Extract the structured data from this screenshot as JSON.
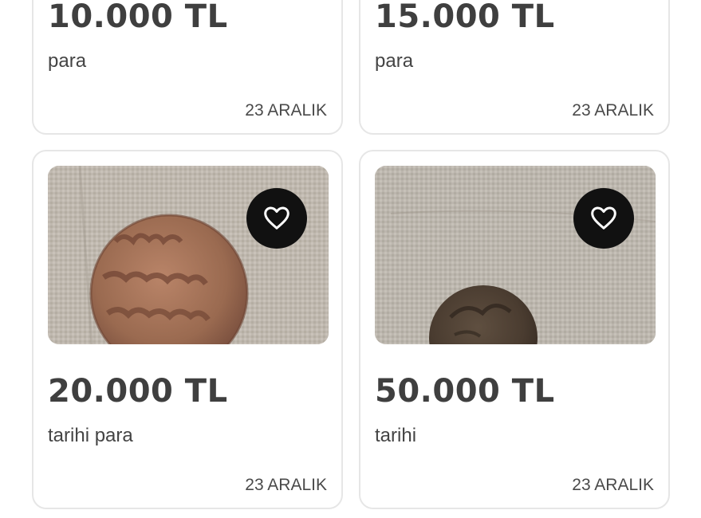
{
  "listings": [
    {
      "price": "10.000 TL",
      "title": "para",
      "date": "23 ARALIK"
    },
    {
      "price": "15.000 TL",
      "title": "para",
      "date": "23 ARALIK"
    },
    {
      "price": "20.000 TL",
      "title": "tarihi para",
      "date": "23 ARALIK",
      "favorite_icon": "heart-outline-icon"
    },
    {
      "price": "50.000 TL",
      "title": "tarihi",
      "date": "23 ARALIK",
      "favorite_icon": "heart-outline-icon"
    }
  ],
  "colors": {
    "price_text": "#3f3f3f",
    "card_border": "#e6e6e6",
    "favorite_button": "#111111"
  }
}
